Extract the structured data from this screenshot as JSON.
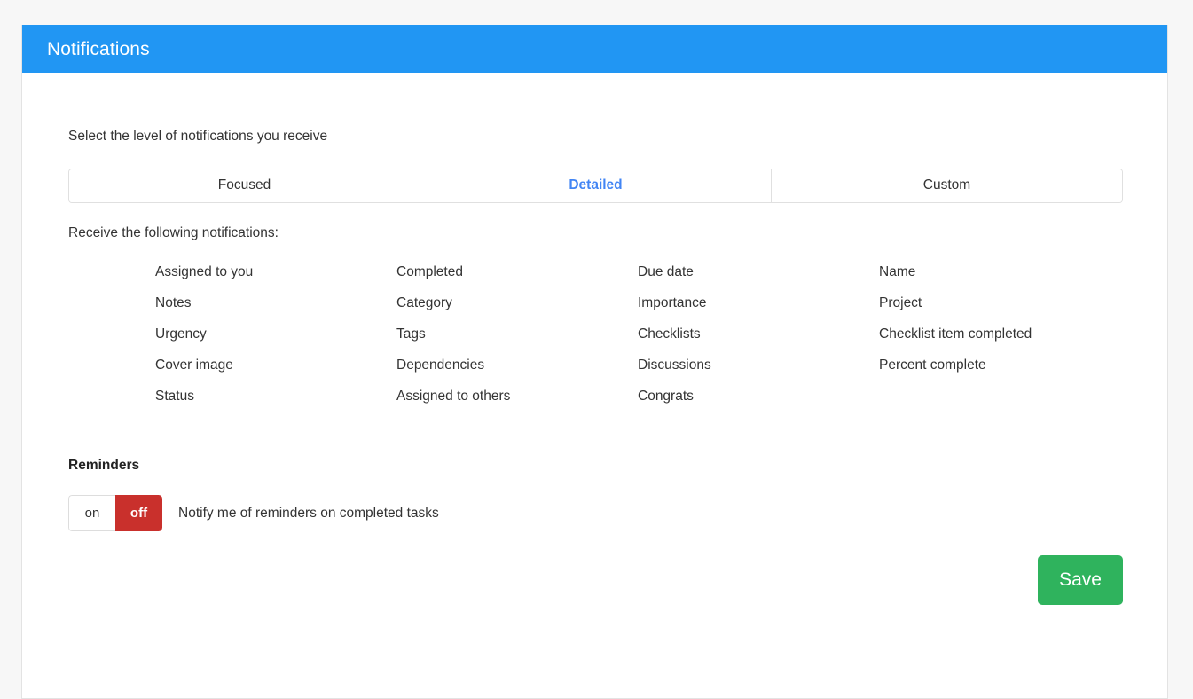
{
  "header": {
    "title": "Notifications",
    "background_color": "#2196f3"
  },
  "level_section": {
    "label": "Select the level of notifications you receive",
    "tabs": [
      {
        "label": "Focused",
        "active": false
      },
      {
        "label": "Detailed",
        "active": true
      },
      {
        "label": "Custom",
        "active": false
      }
    ],
    "active_tab_color": "#4285f4"
  },
  "notifications_section": {
    "label": "Receive the following notifications:",
    "columns": [
      {
        "items": [
          "Assigned to you",
          "Notes",
          "Urgency",
          "Cover image",
          "Status"
        ]
      },
      {
        "items": [
          "Completed",
          "Category",
          "Tags",
          "Dependencies",
          "Assigned to others"
        ]
      },
      {
        "items": [
          "Due date",
          "Importance",
          "Checklists",
          "Discussions",
          "Congrats"
        ]
      },
      {
        "items": [
          "Name",
          "Project",
          "Checklist item completed",
          "Percent complete"
        ]
      }
    ]
  },
  "reminders_section": {
    "title": "Reminders",
    "toggle": {
      "on_label": "on",
      "off_label": "off",
      "selected": "off",
      "selected_color": "#c9302c"
    },
    "description": "Notify me of reminders on completed tasks"
  },
  "footer": {
    "save_label": "Save",
    "save_color": "#2fb35d"
  }
}
